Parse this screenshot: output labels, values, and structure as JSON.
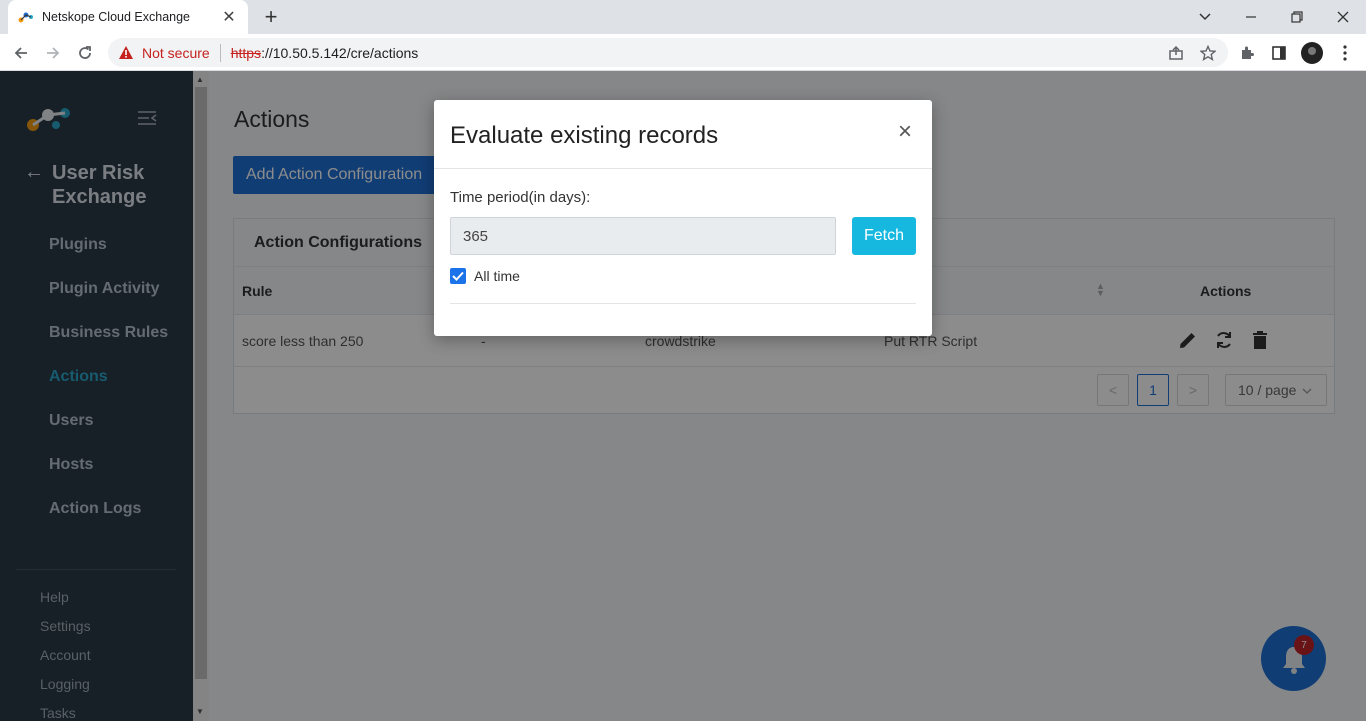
{
  "browser": {
    "tab_title": "Netskope Cloud Exchange",
    "tab_close": "✕",
    "new_tab": "+",
    "security_label": "Not secure",
    "url_scheme": "https",
    "url_rest": "://10.50.5.142/cre/actions"
  },
  "sidebar": {
    "module_title": "User Risk Exchange",
    "back_arrow": "←",
    "items": [
      {
        "label": "Plugins"
      },
      {
        "label": "Plugin Activity"
      },
      {
        "label": "Business Rules"
      },
      {
        "label": "Actions",
        "active": true
      },
      {
        "label": "Users"
      },
      {
        "label": "Hosts"
      },
      {
        "label": "Action Logs"
      }
    ],
    "sub_items": [
      {
        "label": "Help"
      },
      {
        "label": "Settings"
      },
      {
        "label": "Account"
      },
      {
        "label": "Logging"
      },
      {
        "label": "Tasks"
      }
    ]
  },
  "main": {
    "page_title": "Actions",
    "add_button": "Add Action Configuration",
    "card_title": "Action Configurations",
    "columns": {
      "rule": "Rule",
      "actions": "Actions"
    },
    "rows": [
      {
        "rule": "score less than 250",
        "col2": "-",
        "col3": "crowdstrike",
        "col4": "Put RTR Script"
      }
    ],
    "pagination": {
      "prev": "<",
      "current": "1",
      "next": ">",
      "page_size": "10 / page"
    }
  },
  "notifications": {
    "count": "7"
  },
  "modal": {
    "title": "Evaluate existing records",
    "close": "×",
    "field_label": "Time period(in days):",
    "days_value": "365",
    "fetch_label": "Fetch",
    "all_time_label": "All time",
    "all_time_checked": true
  },
  "colors": {
    "sidebar_bg": "#2b3a47",
    "accent": "#1f6fd6",
    "active_nav": "#2ba6cb",
    "fetch_button": "#17b8e0",
    "badge": "#c0242b"
  }
}
